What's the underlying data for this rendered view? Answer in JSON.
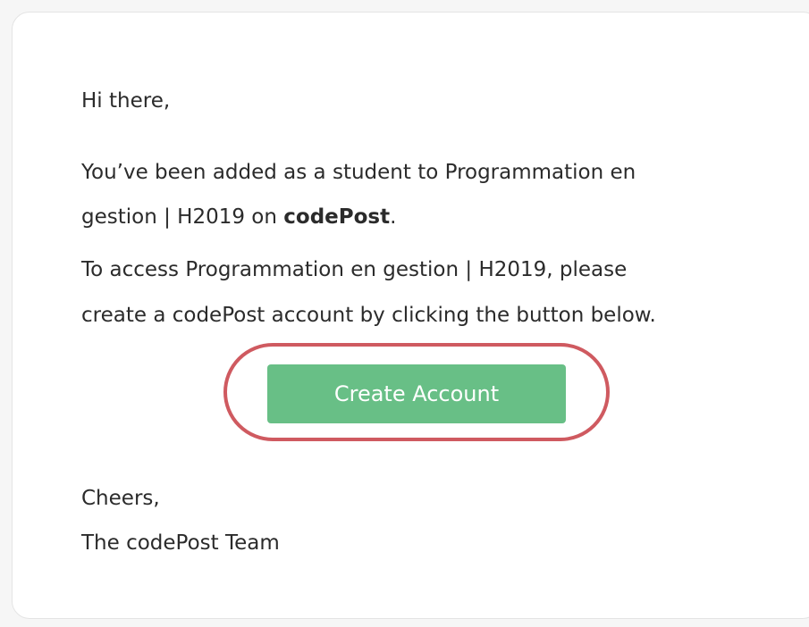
{
  "email": {
    "greeting": "Hi there,",
    "line1": "You’ve been added as a student to Programmation en",
    "line2_prefix": "gestion | H2019 on ",
    "brand": "codePost",
    "line2_suffix": ".",
    "line3": "To access Programmation en gestion | H2019, please",
    "line4": "create a codePost account by clicking the button below.",
    "button_label": "Create Account",
    "signoff": "Cheers,",
    "signature": "The codePost Team"
  },
  "colors": {
    "button": "#68bf86",
    "highlight_ring": "#cf5a60",
    "text": "#2b2b2b"
  }
}
